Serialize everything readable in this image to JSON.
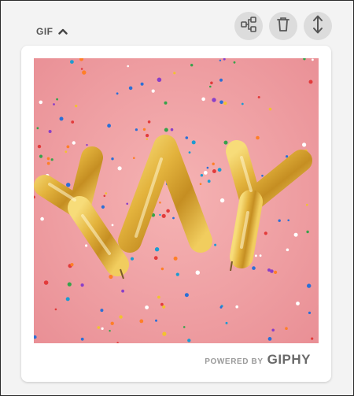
{
  "section": {
    "toggle_label": "GIF",
    "toggle_icon": "chevron-up-icon"
  },
  "toolbar": {
    "buttons": [
      {
        "name": "share-button",
        "icon": "share-nodes-icon"
      },
      {
        "name": "delete-button",
        "icon": "trash-icon"
      },
      {
        "name": "resize-button",
        "icon": "vertical-arrows-icon"
      }
    ]
  },
  "gif": {
    "balloon_text": "YAY",
    "balloon_color": "#e0b23a",
    "background_color": "#f0a3a6"
  },
  "attribution": {
    "powered_by": "POWERED BY",
    "brand": "GIPHY"
  },
  "colors": {
    "page_bg": "#f3f3f3",
    "button_bg": "#dcdcdc",
    "icon_color": "#555555"
  }
}
